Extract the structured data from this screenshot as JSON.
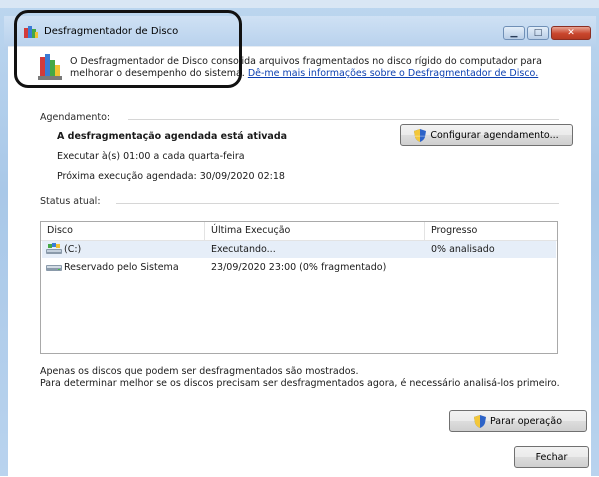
{
  "window": {
    "title": "Desfragmentador de Disco",
    "description_before_link": "O Desfragmentador de Disco consolida arquivos fragmentados no disco rígido do computador para melhorar o desempenho do sistema. ",
    "more_info_link": "Dê-me mais informações sobre o Desfragmentador de Disco."
  },
  "schedule": {
    "section_title": "Agendamento:",
    "status": "A desfragmentação agendada está ativada",
    "run_at": "Executar à(s) 01:00 a cada quarta-feira",
    "next_run": "Próxima execução agendada: 30/09/2020 02:18",
    "configure_button": "Configurar agendamento..."
  },
  "current_status": {
    "section_title": "Status atual:",
    "columns": [
      "Disco",
      "Última Execução",
      "Progresso"
    ],
    "rows": [
      {
        "disk": "(C:)",
        "last_run": "Executando...",
        "progress": "0% analisado"
      },
      {
        "disk": "Reservado pelo Sistema",
        "last_run": "23/09/2020 23:00 (0% fragmentado)",
        "progress": ""
      }
    ]
  },
  "notes": {
    "line1": "Apenas os discos que podem ser desfragmentados são mostrados.",
    "line2": "Para determinar melhor se os discos precisam ser desfragmentados agora, é necessário analisá-los primeiro."
  },
  "buttons": {
    "stop": "Parar operação",
    "close": "Fechar"
  },
  "colors": {
    "link": "#0b3fb0",
    "close_button": "#c9462d",
    "selected_row": "#e6eef8"
  }
}
